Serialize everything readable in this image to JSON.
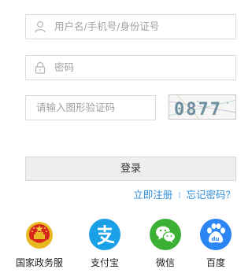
{
  "form": {
    "username_placeholder": "用户名/手机号/身份证号",
    "password_placeholder": "密码",
    "captcha_placeholder": "请输入图形验证码",
    "captcha_code": "0877",
    "login_label": "登录"
  },
  "links": {
    "register": "立即注册",
    "separator": "I",
    "forgot": "忘记密码？"
  },
  "third_party": [
    {
      "label": "国家政务服",
      "icon": "national-emblem-icon",
      "color": "#d7261e"
    },
    {
      "label": "支付宝",
      "icon": "alipay-icon",
      "color": "#1aa0e6"
    },
    {
      "label": "微信",
      "icon": "wechat-icon",
      "color": "#3cb034"
    },
    {
      "label": "百度",
      "icon": "baidu-icon",
      "color": "#2b86f3"
    }
  ]
}
